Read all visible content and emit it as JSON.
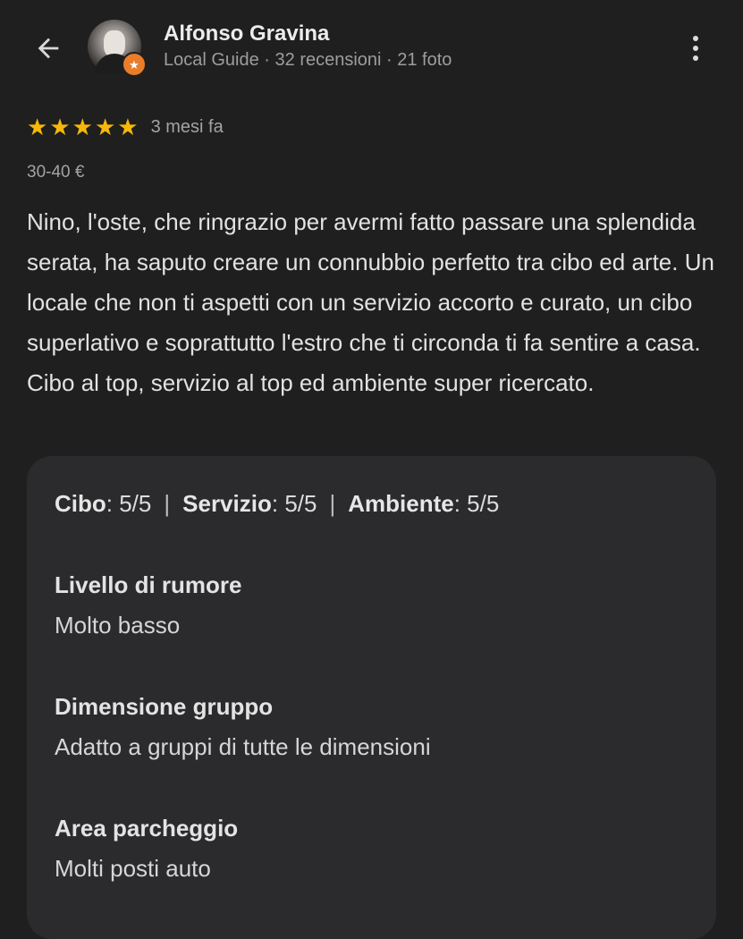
{
  "header": {
    "user_name": "Alfonso Gravina",
    "user_meta": "Local Guide · 32 recensioni · 21 foto",
    "badge_symbol": "★"
  },
  "review": {
    "rating": 5,
    "rating_max": 5,
    "time_ago": "3 mesi fa",
    "price": "30-40 €",
    "text": "Nino, l'oste, che ringrazio per avermi fatto passare una splendida serata, ha saputo creare un connubbio perfetto tra cibo ed arte. Un locale che non ti aspetti con un servizio accorto e curato, un cibo superlativo e soprattutto l'estro che ti circonda ti fa sentire a casa. Cibo al top, servizio al top ed ambiente super ricercato."
  },
  "scores": [
    {
      "label": "Cibo",
      "value": "5/5"
    },
    {
      "label": "Servizio",
      "value": "5/5"
    },
    {
      "label": "Ambiente",
      "value": "5/5"
    }
  ],
  "attributes": [
    {
      "title": "Livello di rumore",
      "value": "Molto basso"
    },
    {
      "title": "Dimensione gruppo",
      "value": "Adatto a gruppi di tutte le dimensioni"
    },
    {
      "title": "Area parcheggio",
      "value": "Molti posti auto"
    }
  ],
  "colors": {
    "background": "#1f1f1f",
    "card": "#2b2b2d",
    "star": "#f6b80b",
    "badge": "#ea7d2a"
  },
  "icons": {
    "back": "arrow-back-icon",
    "more": "more-vert-icon",
    "star": "star-icon"
  }
}
